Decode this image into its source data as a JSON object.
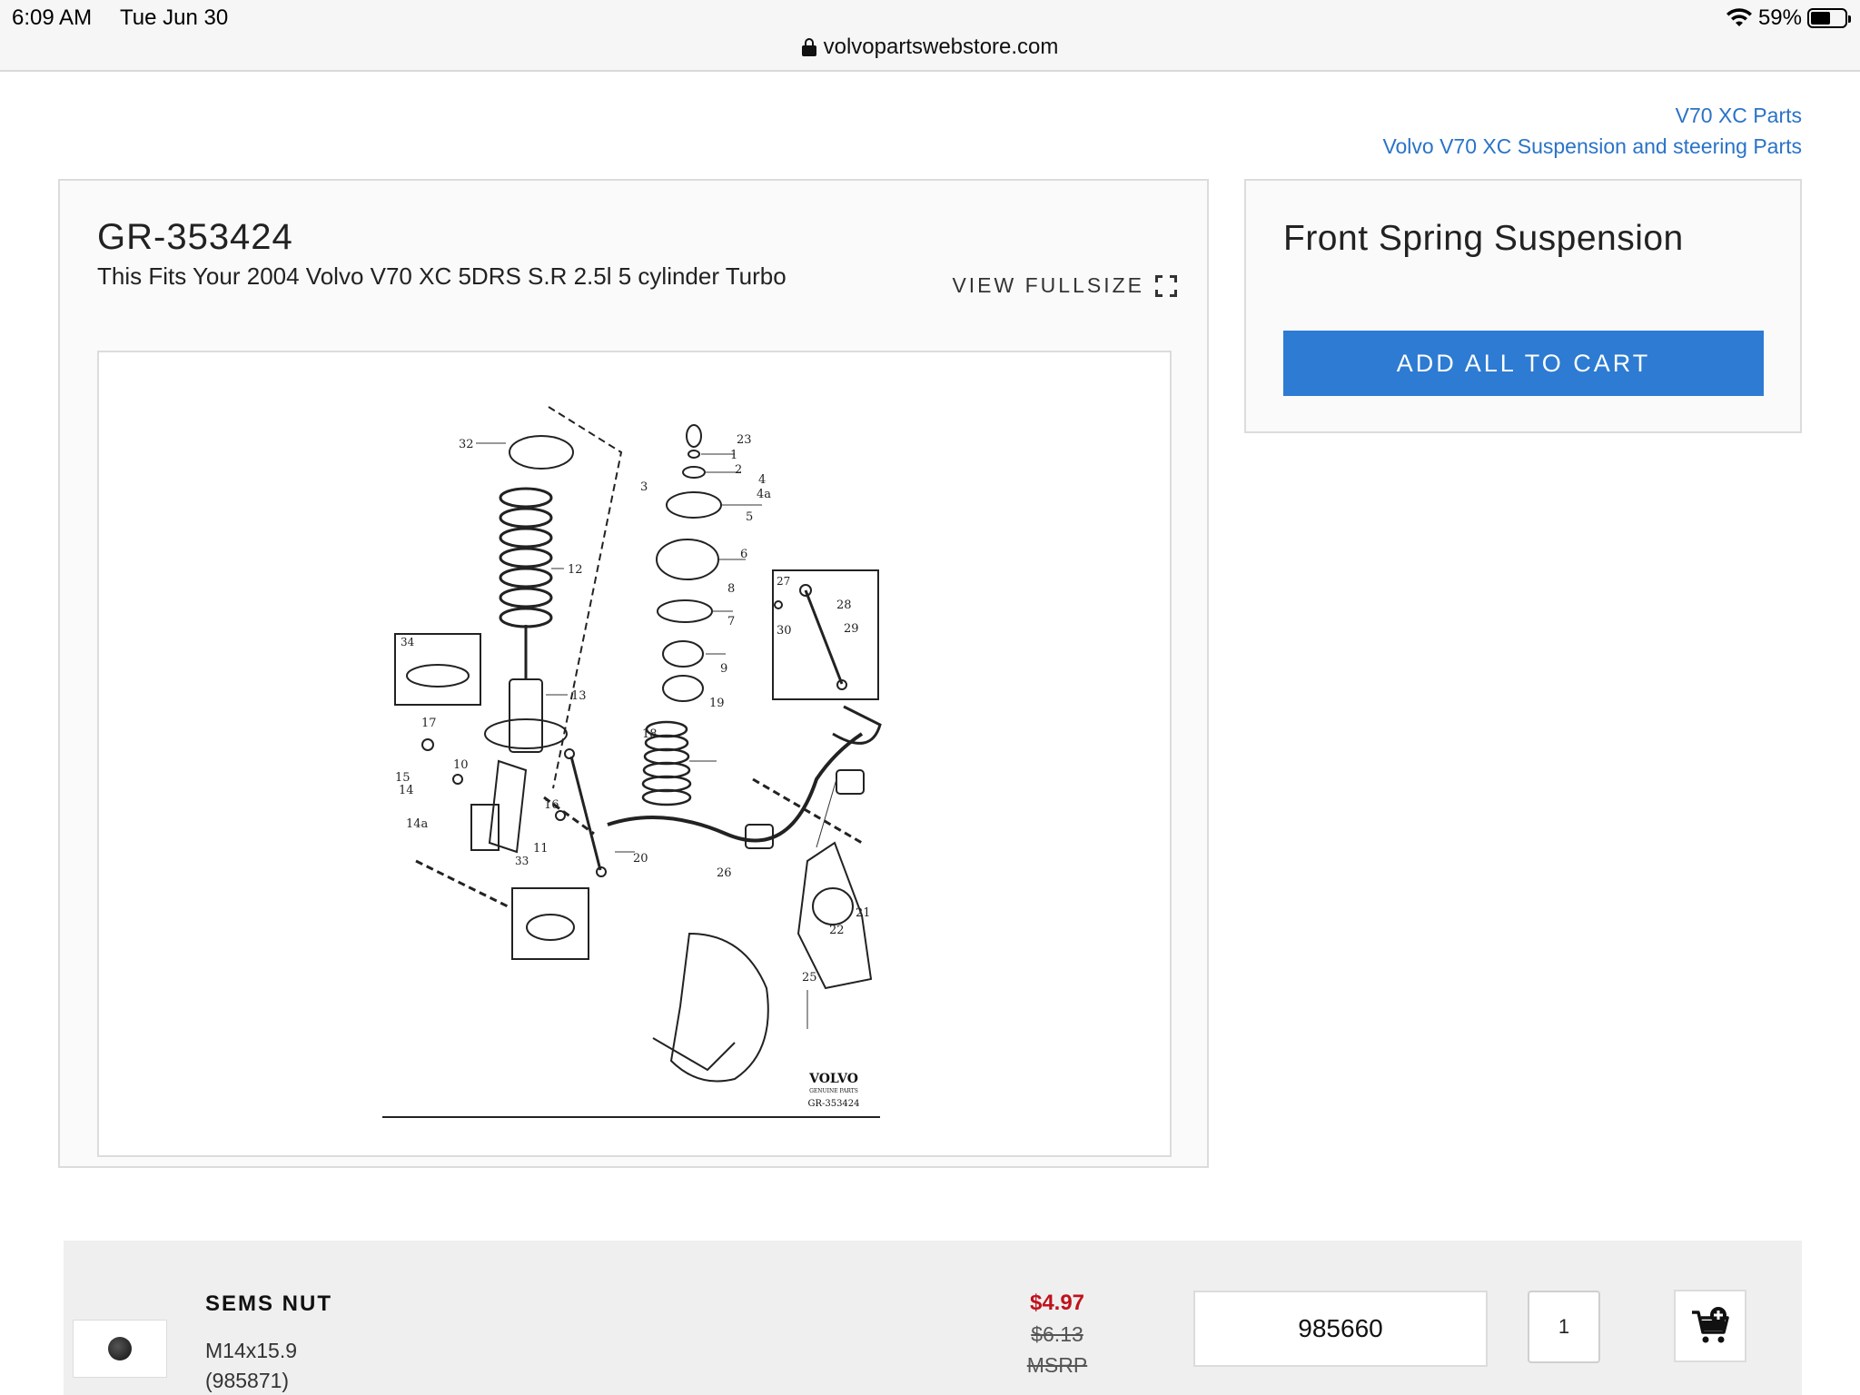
{
  "status_bar": {
    "time": "6:09 AM",
    "date": "Tue Jun 30",
    "battery": "59%",
    "battery_level": 0.59,
    "url": "volvopartswebstore.com"
  },
  "breadcrumbs": [
    "V70 XC Parts",
    "Volvo V70 XC Suspension and steering Parts"
  ],
  "diagram": {
    "code": "GR-353424",
    "fits_text": "This Fits Your 2004 Volvo V70 XC 5DRS S.R 2.5l 5 cylinder Turbo",
    "view_fullsize": "VIEW FULLSIZE",
    "callouts": [
      "32",
      "12",
      "34",
      "13",
      "17",
      "10",
      "15",
      "14",
      "14a",
      "16",
      "11",
      "23",
      "1",
      "2",
      "3",
      "4",
      "4a",
      "5",
      "6",
      "8",
      "7",
      "9",
      "19",
      "18",
      "20",
      "26",
      "21",
      "22",
      "25",
      "27",
      "28",
      "29",
      "30",
      "33"
    ],
    "brand": "VOLVO",
    "brand_sub": "GENUINE PARTS",
    "image_code": "GR-353424"
  },
  "title_card": {
    "title": "Front Spring Suspension",
    "add_all_label": "ADD ALL TO CART"
  },
  "parts": [
    {
      "name": "SEMS NUT",
      "spec": "M14x15.9",
      "number": "(985871)",
      "price": "$4.97",
      "old_price": "$6.13",
      "msrp": "MSRP",
      "part_field": "985660",
      "qty": "1"
    }
  ],
  "colors": {
    "link": "#2a73c7",
    "button": "#2d7bd2",
    "price": "#c0121b"
  }
}
